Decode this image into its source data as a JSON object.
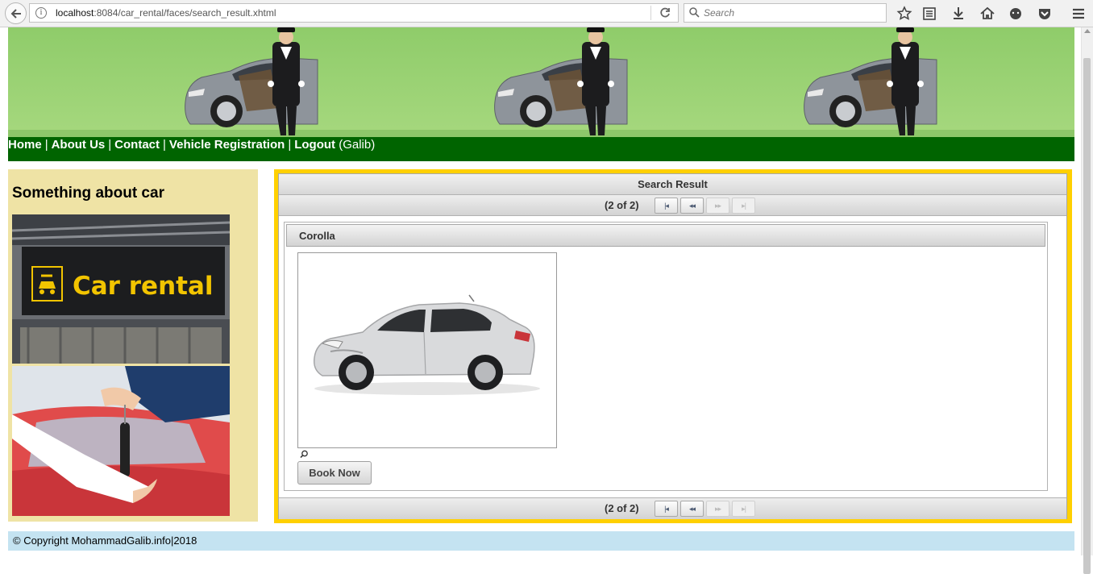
{
  "browser": {
    "url_host": "localhost",
    "url_rest": ":8084/car_rental/faces/search_result.xhtml",
    "search_placeholder": "Search"
  },
  "nav": {
    "home": "Home",
    "about": "About Us",
    "contact": "Contact",
    "vehicle_registration": "Vehicle Registration",
    "logout": "Logout",
    "user": "(Galib)",
    "separator": "|"
  },
  "sidebar": {
    "title": "Something about car",
    "sign_text": "Car rental"
  },
  "result": {
    "header": "Search Result",
    "page_count": "(2 of 2)",
    "paginator_buttons": {
      "first": "|◂",
      "prev": "◂◂",
      "next": "▸▸",
      "last": "▸|"
    },
    "car_name": "Corolla",
    "book_button": "Book Now"
  },
  "footer": {
    "text": "© Copyright MohammadGalib.info|2018"
  },
  "colors": {
    "nav_bg": "#006400",
    "banner_bg": "#9ed378",
    "sidebar_bg": "#efe3a5",
    "result_border": "#ffd000",
    "footer_bg": "#c4e3f1"
  }
}
